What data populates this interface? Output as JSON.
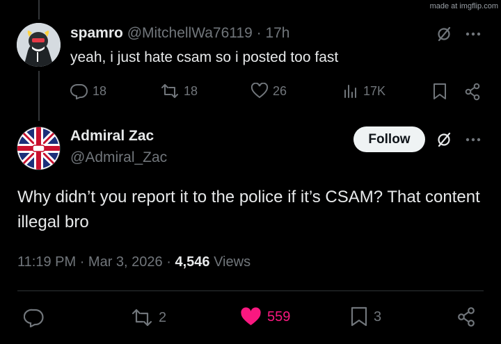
{
  "watermark": "made at imgflip.com",
  "reply": {
    "display_name": "spamro",
    "handle": "@MitchellWa76119",
    "separator": "·",
    "age": "17h",
    "text": "yeah, i just hate csam so i posted too fast",
    "actions": {
      "replies": "18",
      "reposts": "18",
      "likes": "26",
      "views": "17K"
    }
  },
  "main": {
    "display_name": "Admiral Zac",
    "handle": "@Admiral_Zac",
    "follow_label": "Follow",
    "text": "Why didn’t you report it to the police if it’s CSAM? That content illegal bro",
    "time": "11:19 PM",
    "date": "Mar 3, 2026",
    "views_count": "4,546",
    "views_label": "Views",
    "dot": "·",
    "actions": {
      "reposts": "2",
      "likes": "559",
      "bookmarks": "3"
    }
  },
  "colors": {
    "background": "#000000",
    "text": "#e7e9ea",
    "muted": "#71767b",
    "like_active": "#f91880"
  },
  "icons": [
    "reply-icon",
    "repost-icon",
    "like-icon",
    "views-icon",
    "bookmark-icon",
    "share-icon",
    "grok-icon",
    "more-icon"
  ]
}
